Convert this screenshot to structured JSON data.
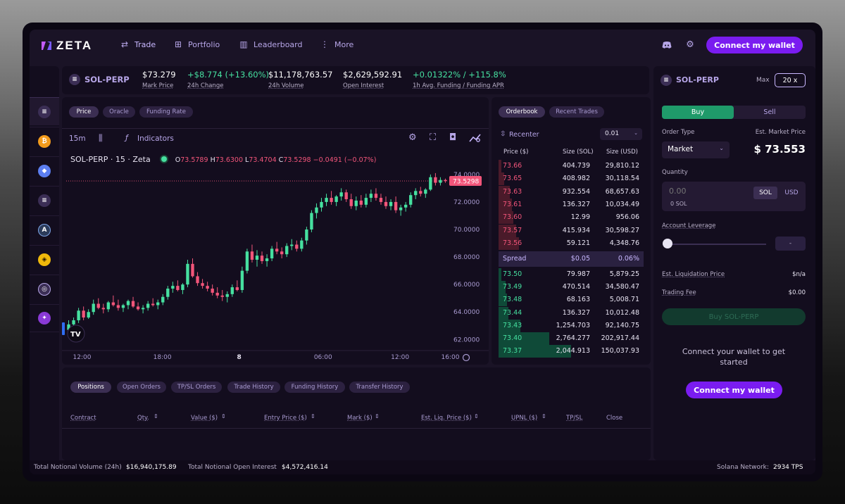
{
  "nav": {
    "logo_text": "ZETA",
    "items": [
      {
        "label": "Trade",
        "icon": "arrows-swap-icon"
      },
      {
        "label": "Portfolio",
        "icon": "grid-icon"
      },
      {
        "label": "Leaderboard",
        "icon": "bar-chart-icon"
      },
      {
        "label": "More",
        "icon": "vertical-dots-icon"
      }
    ],
    "connect_label": "Connect my wallet"
  },
  "ticker": {
    "market": "SOL-PERP",
    "mark_price": "$73.279",
    "mark_price_label": "Mark Price",
    "change": "+$8.774 (+13.60%)",
    "change_label": "24h Change",
    "volume": "$11,178,763.57",
    "volume_label": "24h Volume",
    "open_interest": "$2,629,592.91",
    "open_interest_label": "Open Interest",
    "funding": "+0.01322% / +115.8%",
    "funding_label": "1h Avg. Funding / Funding APR"
  },
  "chart_tabs": [
    "Price",
    "Oracle",
    "Funding Rate"
  ],
  "chart_toolbar": {
    "interval": "15m",
    "indicators": "Indicators"
  },
  "chart_legend": {
    "title": "SOL-PERP · 15 · Zeta",
    "o_label": "O",
    "o": "73.5789",
    "h_label": "H",
    "h": "73.6300",
    "l_label": "L",
    "l": "73.4704",
    "c_label": "C",
    "c": "73.5298",
    "delta": "−0.0491 (−0.07%)"
  },
  "chart_data": {
    "type": "candlestick",
    "current_price": 73.5298,
    "current_price_label": "73.5298",
    "y_ticks": [
      "74.0000",
      "72.0000",
      "70.0000",
      "68.0000",
      "66.0000",
      "64.0000",
      "62.0000"
    ],
    "y_tick_values": [
      74,
      72,
      70,
      68,
      66,
      64,
      62
    ],
    "ylim": [
      61.3,
      74.3
    ],
    "x_ticks": [
      "12:00",
      "18:00",
      "8",
      "06:00",
      "12:00",
      "16:00"
    ],
    "x_tick_index": [
      4,
      52,
      102,
      148,
      194,
      224
    ],
    "ohlc": [
      [
        62.7,
        63.4,
        62.5,
        63.1
      ],
      [
        63.1,
        63.6,
        62.9,
        63.4
      ],
      [
        63.4,
        64.3,
        63.2,
        64.1
      ],
      [
        64.1,
        64.4,
        63.4,
        63.6
      ],
      [
        63.6,
        64.2,
        63.5,
        64.0
      ],
      [
        64.0,
        64.9,
        63.8,
        64.6
      ],
      [
        64.6,
        65.0,
        64.2,
        64.3
      ],
      [
        64.3,
        64.6,
        63.9,
        64.2
      ],
      [
        64.2,
        64.8,
        64.0,
        64.7
      ],
      [
        64.7,
        65.2,
        64.4,
        64.5
      ],
      [
        64.5,
        64.9,
        64.1,
        64.3
      ],
      [
        64.3,
        64.6,
        64.0,
        64.5
      ],
      [
        64.5,
        64.9,
        64.2,
        64.8
      ],
      [
        64.8,
        65.1,
        64.3,
        64.4
      ],
      [
        64.4,
        64.7,
        64.1,
        64.2
      ],
      [
        64.2,
        64.5,
        63.9,
        64.3
      ],
      [
        64.3,
        64.8,
        64.1,
        64.6
      ],
      [
        64.6,
        65.0,
        64.4,
        64.5
      ],
      [
        64.5,
        64.9,
        64.2,
        64.7
      ],
      [
        64.7,
        65.3,
        64.5,
        65.1
      ],
      [
        65.1,
        65.9,
        64.9,
        65.7
      ],
      [
        65.7,
        66.2,
        65.4,
        65.9
      ],
      [
        65.9,
        66.3,
        65.5,
        65.6
      ],
      [
        65.6,
        66.1,
        65.3,
        66.0
      ],
      [
        66.0,
        67.8,
        65.8,
        67.5
      ],
      [
        67.5,
        67.9,
        66.5,
        66.6
      ],
      [
        66.6,
        66.9,
        65.9,
        66.1
      ],
      [
        66.1,
        66.4,
        65.7,
        65.9
      ],
      [
        65.9,
        66.2,
        65.5,
        65.7
      ],
      [
        65.7,
        66.0,
        65.2,
        65.4
      ],
      [
        65.4,
        65.8,
        65.0,
        65.2
      ],
      [
        65.2,
        65.6,
        64.8,
        65.1
      ],
      [
        65.1,
        65.5,
        64.7,
        65.3
      ],
      [
        65.3,
        66.0,
        65.1,
        65.8
      ],
      [
        65.8,
        66.3,
        65.5,
        65.6
      ],
      [
        65.6,
        67.3,
        65.4,
        67.0
      ],
      [
        67.0,
        68.6,
        66.8,
        68.4
      ],
      [
        68.4,
        68.9,
        67.6,
        67.8
      ],
      [
        67.8,
        68.5,
        67.3,
        68.1
      ],
      [
        68.1,
        68.4,
        67.5,
        67.7
      ],
      [
        67.7,
        68.2,
        67.3,
        67.9
      ],
      [
        67.9,
        68.8,
        67.7,
        68.6
      ],
      [
        68.6,
        69.1,
        68.2,
        68.4
      ],
      [
        68.4,
        68.7,
        67.9,
        68.2
      ],
      [
        68.2,
        69.0,
        68.0,
        68.8
      ],
      [
        68.8,
        69.3,
        68.5,
        68.9
      ],
      [
        68.9,
        69.2,
        68.4,
        68.6
      ],
      [
        68.6,
        69.4,
        68.4,
        69.2
      ],
      [
        69.2,
        70.2,
        68.9,
        70.0
      ],
      [
        70.0,
        71.4,
        69.8,
        71.2
      ],
      [
        71.2,
        71.9,
        70.8,
        71.6
      ],
      [
        71.6,
        72.3,
        71.3,
        72.0
      ],
      [
        72.0,
        72.6,
        71.7,
        72.3
      ],
      [
        72.3,
        72.8,
        71.8,
        72.0
      ],
      [
        72.0,
        72.5,
        71.7,
        72.4
      ],
      [
        72.4,
        73.0,
        72.1,
        72.7
      ],
      [
        72.7,
        72.9,
        72.0,
        72.2
      ],
      [
        72.2,
        72.6,
        71.5,
        71.7
      ],
      [
        71.7,
        72.4,
        71.4,
        72.1
      ],
      [
        72.1,
        72.5,
        71.6,
        71.8
      ],
      [
        71.8,
        72.6,
        71.6,
        72.3
      ],
      [
        72.3,
        72.9,
        72.0,
        72.6
      ],
      [
        72.6,
        73.0,
        72.1,
        72.3
      ],
      [
        72.3,
        72.6,
        71.8,
        72.0
      ],
      [
        72.0,
        72.4,
        71.5,
        71.7
      ],
      [
        71.7,
        72.2,
        71.4,
        72.0
      ],
      [
        72.0,
        72.4,
        71.2,
        71.4
      ],
      [
        71.4,
        71.8,
        71.0,
        71.6
      ],
      [
        71.6,
        72.0,
        71.3,
        71.8
      ],
      [
        71.8,
        72.7,
        71.6,
        72.5
      ],
      [
        72.5,
        73.0,
        72.2,
        72.8
      ],
      [
        72.8,
        73.1,
        72.4,
        72.6
      ],
      [
        72.6,
        73.0,
        72.3,
        72.9
      ],
      [
        72.9,
        74.0,
        72.8,
        73.8
      ],
      [
        73.8,
        74.1,
        73.2,
        73.4
      ],
      [
        73.4,
        73.8,
        73.2,
        73.6
      ],
      [
        73.6,
        73.7,
        73.4,
        73.53
      ]
    ]
  },
  "orderbook": {
    "tabs": [
      "Orderbook",
      "Recent Trades"
    ],
    "recenter": "Recenter",
    "tick": "0.01",
    "headers": [
      "Price ($)",
      "Size (SOL)",
      "Size (USD)"
    ],
    "asks": [
      {
        "price": "73.66",
        "size": "404.739",
        "usd": "29,810.12",
        "depth": 0.02
      },
      {
        "price": "73.65",
        "size": "408.982",
        "usd": "30,118.54",
        "depth": 0.04
      },
      {
        "price": "73.63",
        "size": "932.554",
        "usd": "68,657.63",
        "depth": 0.08
      },
      {
        "price": "73.61",
        "size": "136.327",
        "usd": "10,034.49",
        "depth": 0.09
      },
      {
        "price": "73.60",
        "size": "12.99",
        "usd": "956.06",
        "depth": 0.1
      },
      {
        "price": "73.57",
        "size": "415.934",
        "usd": "30,598.27",
        "depth": 0.12
      },
      {
        "price": "73.56",
        "size": "59.121",
        "usd": "4,348.76",
        "depth": 0.14
      }
    ],
    "spread_label": "Spread",
    "spread_value": "$0.05",
    "spread_pct": "0.06%",
    "bids": [
      {
        "price": "73.50",
        "size": "79.987",
        "usd": "5,879.25",
        "depth": 0.02
      },
      {
        "price": "73.49",
        "size": "470.514",
        "usd": "34,580.47",
        "depth": 0.05
      },
      {
        "price": "73.48",
        "size": "68.163",
        "usd": "5,008.71",
        "depth": 0.06
      },
      {
        "price": "73.44",
        "size": "136.327",
        "usd": "10,012.48",
        "depth": 0.07
      },
      {
        "price": "73.43",
        "size": "1,254.703",
        "usd": "92,140.75",
        "depth": 0.15
      },
      {
        "price": "73.40",
        "size": "2,764.277",
        "usd": "202,917.44",
        "depth": 0.35
      },
      {
        "price": "73.37",
        "size": "2,044.913",
        "usd": "150,037.93",
        "depth": 0.5
      }
    ]
  },
  "bottom": {
    "tabs": [
      "Positions",
      "Open Orders",
      "TP/SL Orders",
      "Trade History",
      "Funding History",
      "Transfer History"
    ],
    "columns": [
      "Contract",
      "Qty.",
      "Value ($)",
      "Entry Price ($)",
      "Mark ($)",
      "Est. Liq. Price ($)",
      "UPNL ($)",
      "TP/SL",
      "Close"
    ]
  },
  "order": {
    "market": "SOL-PERP",
    "max_label": "Max",
    "leverage": "20 x",
    "buy": "Buy",
    "sell": "Sell",
    "order_type_label": "Order Type",
    "order_type": "Market",
    "est_price_label": "Est. Market Price",
    "est_price": "$ 73.553",
    "quantity_label": "Quantity",
    "quantity_placeholder": "0.00",
    "quantity_sub": "0 SOL",
    "unit_sol": "SOL",
    "unit_usd": "USD",
    "account_leverage_label": "Account Leverage",
    "leverage_value": "-",
    "liq_label": "Est. Liquidation Price",
    "liq_value": "$n/a",
    "fee_label": "Trading Fee",
    "fee_value": "$0.00",
    "submit_label": "Buy SOL-PERP",
    "connect_text": "Connect your wallet to get started",
    "connect_label": "Connect my wallet"
  },
  "footer": {
    "volume_label": "Total Notional Volume (24h)",
    "volume": "$16,940,175.89",
    "oi_label": "Total Notional Open Interest",
    "oi": "$4,572,416.14",
    "network_label": "Solana Network:",
    "tps": "2934 TPS"
  },
  "colors": {
    "accent": "#7a1cf0",
    "up": "#46e0a0",
    "down": "#f2557a",
    "buy": "#1f9a6a"
  },
  "sidebar_icons": [
    "sol-icon",
    "btc-icon",
    "eth-icon",
    "sol-alt-icon",
    "arb-icon",
    "bnb-icon",
    "token-icon",
    "matic-icon"
  ]
}
